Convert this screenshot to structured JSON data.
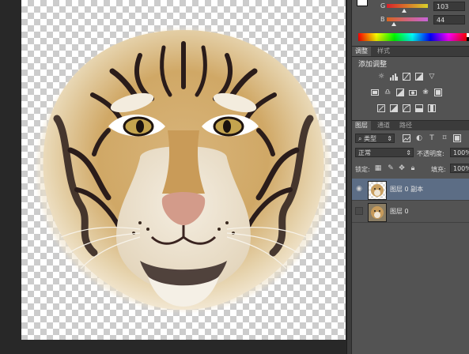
{
  "color_panel": {
    "g_label": "G",
    "b_label": "B",
    "g_value": "103",
    "b_value": "44",
    "g_value_fraction": 0.404,
    "b_value_fraction": 0.173,
    "foreground_color": "#ffffff",
    "background_color": "#000000"
  },
  "adjustments": {
    "tabs": [
      "调整",
      "样式"
    ],
    "title": "添加调整",
    "row1_icons": [
      "brightness-contrast-icon",
      "levels-icon",
      "curves-icon",
      "exposure-icon",
      "vibrance-icon"
    ],
    "row2_icons": [
      "hue-saturation-icon",
      "color-balance-icon",
      "black-white-icon",
      "photo-filter-icon",
      "channel-mixer-icon",
      "color-lookup-icon"
    ],
    "row3_icons": [
      "invert-icon",
      "posterize-icon",
      "threshold-icon",
      "selective-color-icon",
      "gradient-map-icon"
    ]
  },
  "layers_panel": {
    "tabs": [
      "图层",
      "通道",
      "路径"
    ],
    "filter_kind": "类型",
    "blend_mode": "正常",
    "opacity_label": "不透明度:",
    "opacity_value": "100%",
    "lock_label": "锁定:",
    "fill_label": "填充:",
    "fill_value": "100%",
    "layers": [
      {
        "name": "图层 0 副本",
        "visible": true,
        "selected": true
      },
      {
        "name": "图层 0",
        "visible": false,
        "selected": false
      }
    ]
  },
  "colors": {
    "selected_layer": "#5c6d85",
    "panel_bg": "#535353",
    "workspace_bg": "#282828"
  }
}
